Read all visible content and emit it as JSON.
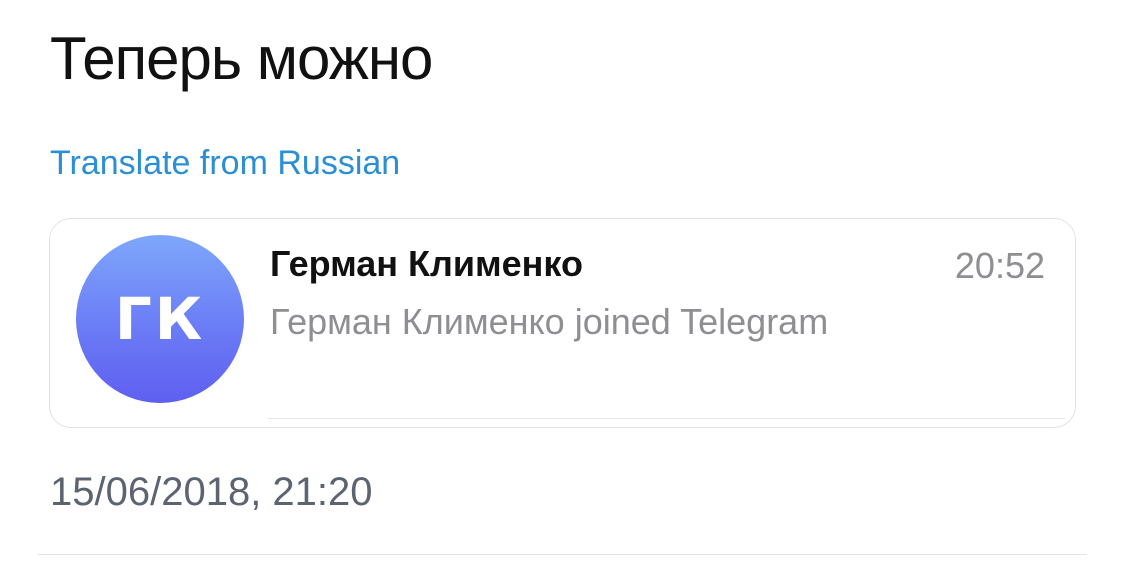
{
  "post": {
    "text": "Теперь можно",
    "translate_label": "Translate from Russian",
    "timestamp": "15/06/2018, 21:20"
  },
  "notification": {
    "avatar_initials": "ГК",
    "contact_name": "Герман Клименко",
    "time": "20:52",
    "preview": "Герман Клименко joined Telegram"
  },
  "colors": {
    "link": "#2a8fd6",
    "avatar_gradient_top": "#7ea7fb",
    "avatar_gradient_bottom": "#5f5ff0",
    "secondary_text": "#8e8e93"
  }
}
